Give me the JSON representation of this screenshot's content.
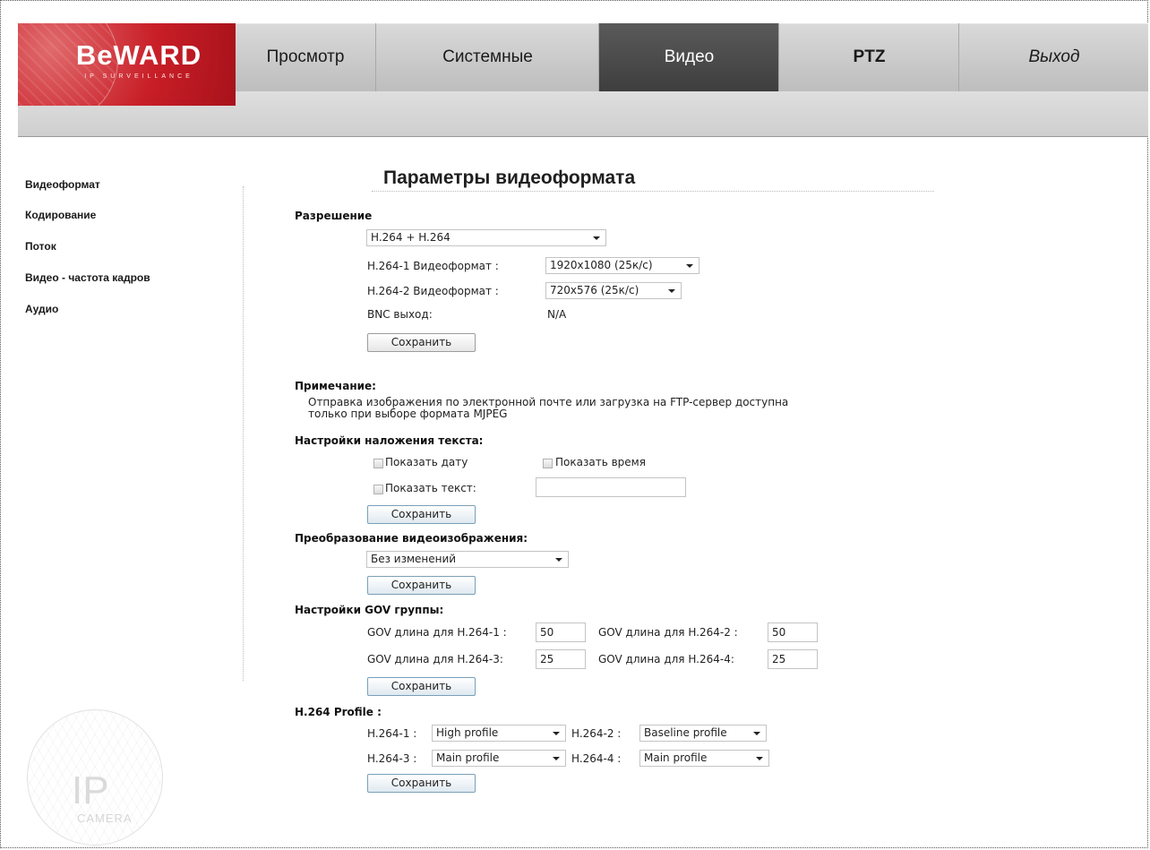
{
  "brand": {
    "name": "BeWARD",
    "tagline": "IP SURVEILLANCE"
  },
  "nav": [
    "Просмотр",
    "Системные",
    "Видео",
    "PTZ",
    "Выход"
  ],
  "sidebar": [
    "Видеоформат",
    "Кодирование",
    "Поток",
    "Видео - частота кадров",
    "Аудио"
  ],
  "watermark": {
    "big": "IP",
    "small": "CAMERA"
  },
  "page_title": "Параметры видеоформата",
  "resolution": {
    "heading": "Разрешение",
    "codec_value": "H.264 + H.264",
    "h264_1_label": "H.264-1 Видеоформат :",
    "h264_1_value": "1920x1080 (25к/с)",
    "h264_2_label": "H.264-2 Видеоформат :",
    "h264_2_value": "720x576 (25к/с)",
    "bnc_label": "BNC выход:",
    "bnc_value": "N/A",
    "save": "Сохранить"
  },
  "note": {
    "heading": "Примечание:",
    "line1": "Отправка изображения по электронной почте или загрузка на FTP-сервер доступна",
    "line2": "только при выборе формата MJPEG"
  },
  "overlay": {
    "heading": "Настройки наложения текста:",
    "show_date": "Показать дату",
    "show_time": "Показать время",
    "show_text": "Показать текст:",
    "text_value": "",
    "save": "Сохранить"
  },
  "transform": {
    "heading": "Преобразование видеоизображения:",
    "value": "Без изменений",
    "save": "Сохранить"
  },
  "gov": {
    "heading": "Настройки GOV группы:",
    "l1": "GOV длина для H.264-1 :",
    "v1": "50",
    "l2": "GOV длина для H.264-2 :",
    "v2": "50",
    "l3": "GOV длина для H.264-3:",
    "v3": "25",
    "l4": "GOV длина для H.264-4:",
    "v4": "25",
    "save": "Сохранить"
  },
  "profile": {
    "heading": "H.264 Profile :",
    "l1": "H.264-1 :",
    "v1": "High profile",
    "l2": "H.264-2 :",
    "v2": "Baseline profile",
    "l3": "H.264-3 :",
    "v3": "Main profile",
    "l4": "H.264-4 :",
    "v4": "Main profile",
    "save": "Сохранить"
  }
}
